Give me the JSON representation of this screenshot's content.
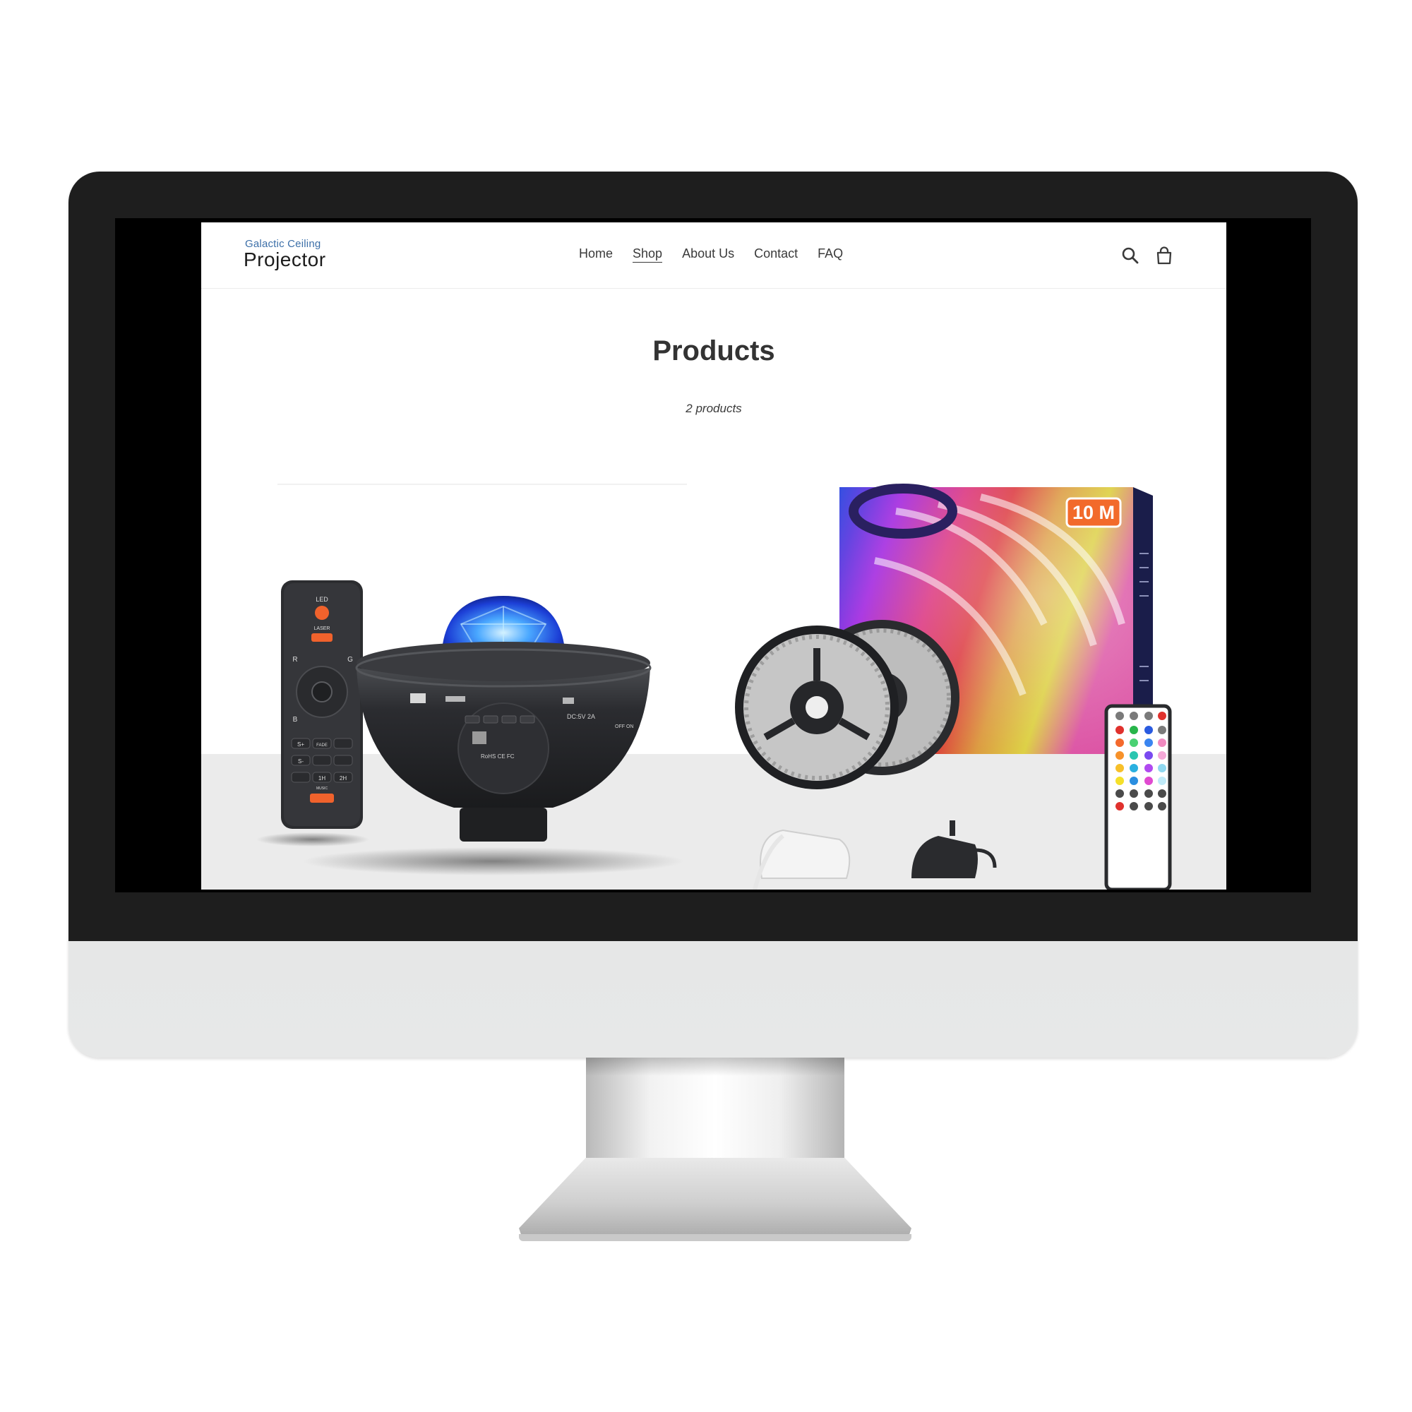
{
  "store": {
    "logo_line1": "Galactic Ceiling",
    "logo_line2": "Projector"
  },
  "nav": {
    "items": [
      {
        "label": "Home"
      },
      {
        "label": "Shop",
        "active": true
      },
      {
        "label": "About Us"
      },
      {
        "label": "Contact"
      },
      {
        "label": "FAQ"
      }
    ]
  },
  "icons": {
    "search": "search-icon",
    "cart": "cart-icon"
  },
  "collection": {
    "title": "Products",
    "count_text": "2 products"
  },
  "products": [
    {
      "image": "galaxy-projector-with-remote",
      "remote_labels": [
        "LED",
        "LASER",
        "R",
        "G",
        "B",
        "S+",
        "S-",
        "1H",
        "2H",
        "FADE",
        "MUSIC"
      ],
      "device_labels": [
        "DC:5V 2A",
        "OFF ON",
        "RoHS CE FC"
      ]
    },
    {
      "image": "led-strip-lights-kit",
      "badge": "10 M"
    }
  ],
  "colors": {
    "bezel": "#1e1e1e",
    "text": "#333333",
    "logo_accent": "#3c6fa8",
    "badge_orange": "#f26a2b"
  }
}
